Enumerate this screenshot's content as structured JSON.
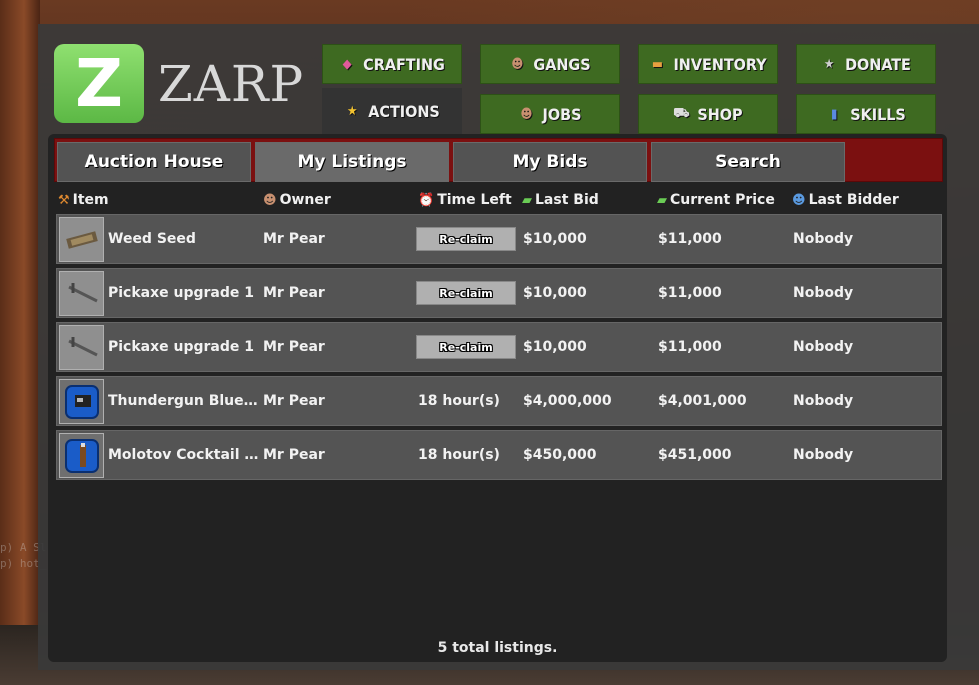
{
  "logo": {
    "badge_letter": "Z",
    "text": "ZARP"
  },
  "nav": {
    "crafting": "CRAFTING",
    "gangs": "GANGS",
    "inventory": "INVENTORY",
    "donate": "DONATE",
    "actions": "ACTIONS",
    "jobs": "JOBS",
    "shop": "SHOP",
    "skills": "SKILLS"
  },
  "tabs": [
    "Auction House",
    "My Listings",
    "My Bids",
    "Search"
  ],
  "active_tab": "My Listings",
  "columns": {
    "item": "Item",
    "owner": "Owner",
    "time_left": "Time Left",
    "last_bid": "Last Bid",
    "current_price": "Current Price",
    "last_bidder": "Last Bidder"
  },
  "listings": [
    {
      "item": "Weed Seed",
      "owner": "Mr Pear",
      "time_left": "Re-claim",
      "reclaim": true,
      "last_bid": "$10,000",
      "current_price": "$11,000",
      "last_bidder": "Nobody",
      "icon": "weed-seed-icon"
    },
    {
      "item": "Pickaxe upgrade 1",
      "owner": "Mr Pear",
      "time_left": "Re-claim",
      "reclaim": true,
      "last_bid": "$10,000",
      "current_price": "$11,000",
      "last_bidder": "Nobody",
      "icon": "pickaxe-icon"
    },
    {
      "item": "Pickaxe upgrade 1",
      "owner": "Mr Pear",
      "time_left": "Re-claim",
      "reclaim": true,
      "last_bid": "$10,000",
      "current_price": "$11,000",
      "last_bidder": "Nobody",
      "icon": "pickaxe-icon"
    },
    {
      "item": "Thundergun Blue…",
      "owner": "Mr Pear",
      "time_left": "18 hour(s)",
      "reclaim": false,
      "last_bid": "$4,000,000",
      "current_price": "$4,001,000",
      "last_bidder": "Nobody",
      "icon": "blueprint-icon"
    },
    {
      "item": "Molotov Cocktail …",
      "owner": "Mr Pear",
      "time_left": "18 hour(s)",
      "reclaim": false,
      "last_bid": "$450,000",
      "current_price": "$451,000",
      "last_bidder": "Nobody",
      "icon": "blueprint-icon"
    }
  ],
  "footer": "5 total listings.",
  "chat": [
    "p) A Sl",
    "p) hot_"
  ],
  "colors": {
    "nav_green": "#3e6a21",
    "tab_bar_red": "#7b1010",
    "row_gray": "#545454",
    "logo_green": "#6fcc55"
  }
}
